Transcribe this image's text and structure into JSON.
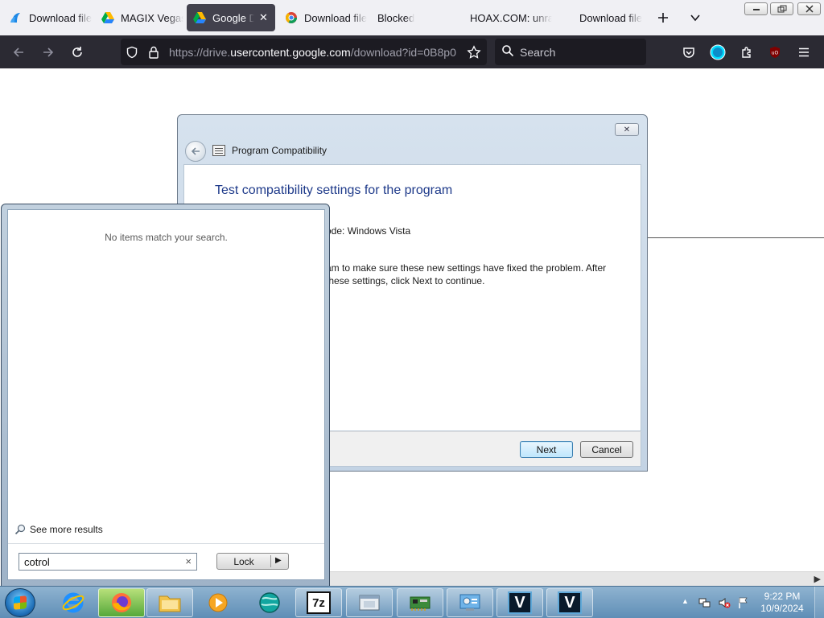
{
  "browser": {
    "tabs": [
      {
        "label": "Download file",
        "icon": "app-favicon"
      },
      {
        "label": "MAGIX Vegas",
        "icon": "google-drive-favicon"
      },
      {
        "label": "Google Drive",
        "icon": "google-drive-favicon",
        "active": true
      },
      {
        "label": "Download file",
        "icon": "chrome-favicon"
      },
      {
        "label": "Blocked",
        "icon": ""
      },
      {
        "label": "HOAX.COM: unra",
        "icon": ""
      },
      {
        "label": "Download file",
        "icon": ""
      }
    ],
    "url_prefix": "https://drive.",
    "url_host": "usercontent.google.com",
    "url_rest": "/download?id=0B8p0",
    "search_placeholder": "Search",
    "colors": {
      "tabstrip": "#f0f0f4",
      "navbar": "#2b2a33",
      "urlbar": "#1c1b22"
    }
  },
  "dialog": {
    "title": "Program Compatibility",
    "heading": "Test compatibility settings for the program",
    "line1": "ode: Windows Vista",
    "line2a": "am to make sure these new settings have fixed the problem. After",
    "line2b": "these settings, click Next to continue.",
    "next_label": "Next",
    "cancel_label": "Cancel",
    "close_glyph": "✕"
  },
  "startmenu": {
    "no_items": "No items match your search.",
    "see_more": "See more results",
    "search_value": "cotrol",
    "lock_label": "Lock"
  },
  "taskbar": {
    "time": "9:22 PM",
    "date": "10/9/2024",
    "items": [
      "internet-explorer-icon",
      "firefox-icon",
      "file-explorer-icon",
      "media-player-icon",
      "browser-globe-icon",
      "7zip-icon",
      "window-icon",
      "network-card-icon",
      "control-panel-icon",
      "vegas-icon",
      "vegas-icon"
    ],
    "zip_label": "7z",
    "v_label": "V"
  }
}
